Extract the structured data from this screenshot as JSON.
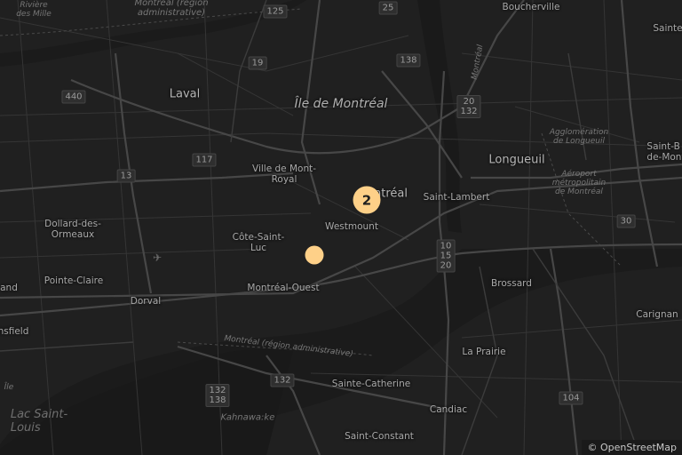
{
  "map": {
    "attribution": "© OpenStreetMap",
    "colors": {
      "background": "#202020",
      "road": "#383838",
      "major_road": "#454545",
      "water": "#1a1a1a",
      "marker": "#fed088"
    },
    "labels": {
      "laval": "Laval",
      "ile_de_montreal": "Île de Montréal",
      "longueuil": "Longueuil",
      "boucherville": "Boucherville",
      "sainte_julie": "Sainte",
      "saint_bruno_1": "Saint-B",
      "saint_bruno_2": "de-Mont",
      "ville_mont_royal_1": "Ville de Mont-",
      "ville_mont_royal_2": "Royal",
      "montreal_partial": "ntréal",
      "saint_lambert": "Saint-Lambert",
      "westmount": "Westmount",
      "dollard_1": "Dollard-des-",
      "dollard_2": "Ormeaux",
      "cote_saint_luc_1": "Côte-Saint-",
      "cote_saint_luc_2": "Luc",
      "pointe_claire": "Pointe-Claire",
      "kirkland_partial": "and",
      "dorval": "Dorval",
      "montreal_ouest": "Montréal-Ouest",
      "brossard": "Brossard",
      "carignan": "Carignan",
      "pincourt_partial": "nsfield",
      "la_prairie": "La Prairie",
      "sainte_catherine": "Sainte-Catherine",
      "candiac": "Candiac",
      "saint_constant": "Saint-Constant",
      "kahnawake": "Kahnawa:ke",
      "lac_saint_louis_1": "Lac Saint-",
      "lac_saint_louis_2": "Louis",
      "riviere_mille_iles_1": "Rivière",
      "riviere_mille_iles_2": "des Mille",
      "montreal_region_top": "Montréal (région",
      "montreal_region_top_2": "administrative)",
      "montreal_region_bottom": "Montréal (région administrative)",
      "montreal_vertical": "Montréal",
      "agglomeration_1": "Agglomération",
      "agglomeration_2": "de Longueuil",
      "aeroport_1": "Aéroport",
      "aeroport_2": "métropolitain",
      "aeroport_3": "de Montréal",
      "ile_partial": "Île"
    },
    "shields": {
      "r125": "125",
      "r25": "25",
      "r19": "19",
      "r138": "138",
      "r440": "440",
      "r117": "117",
      "r13": "13",
      "r20_132_a": "20",
      "r20_132_b": "132",
      "r30": "30",
      "r10_15_20_a": "10",
      "r10_15_20_b": "15",
      "r10_15_20_c": "20",
      "r132_138_a": "132",
      "r132_138_b": "138",
      "r132": "132",
      "r104": "104"
    },
    "markers": [
      {
        "label": "2",
        "kind": "cluster"
      },
      {
        "label": "",
        "kind": "single"
      }
    ]
  }
}
